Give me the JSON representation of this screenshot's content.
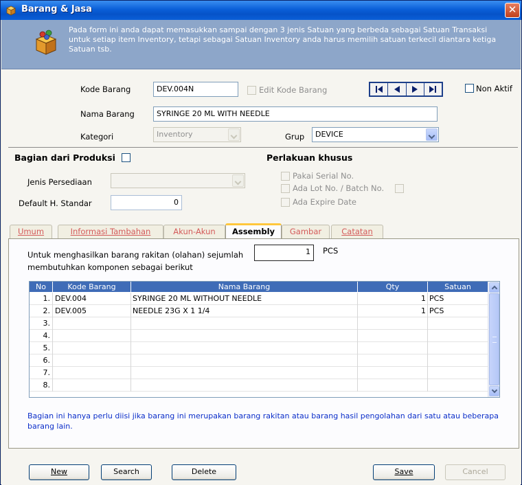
{
  "window": {
    "title": "Barang & Jasa",
    "close_glyph": "✕",
    "icon": "box-icon"
  },
  "info": {
    "text": "Pada form ini anda dapat memasukkan sampai dengan 3 jenis Satuan yang berbeda sebagai Satuan Transaksi untuk setiap item Inventory, tetapi sebagai Satuan Inventory anda harus memilih satuan terkecil diantara ketiga Satuan  tsb.",
    "icon": "package-icon"
  },
  "header": {
    "kode_label": "Kode Barang",
    "kode_value": "DEV.004N",
    "edit_kode_label": "Edit Kode Barang",
    "nama_label": "Nama Barang",
    "nama_value": "SYRINGE 20 ML WITH NEEDLE",
    "kategori_label": "Kategori",
    "kategori_value": "Inventory",
    "grup_label": "Grup",
    "grup_value": "DEVICE",
    "non_aktif_label": "Non Aktif"
  },
  "produksi": {
    "title": "Bagian dari Produksi",
    "jenis_label": "Jenis Persediaan",
    "jenis_value": "",
    "default_label": "Default H. Standar",
    "default_value": "0"
  },
  "perlakuan": {
    "title": "Perlakuan khusus",
    "serial_label": "Pakai Serial No.",
    "lot_label": "Ada Lot No. / Batch No.",
    "expire_label": "Ada Expire Date"
  },
  "tabs": [
    {
      "label": "Umum"
    },
    {
      "label": "Informasi Tambahan"
    },
    {
      "label": "Akun-Akun"
    },
    {
      "label": "Assembly"
    },
    {
      "label": "Gambar"
    },
    {
      "label": "Catatan"
    }
  ],
  "assembly": {
    "intro_line1": "Untuk menghasilkan barang rakitan (olahan) sejumlah",
    "intro_line2": "membutuhkan komponen sebagai berikut",
    "qty_value": "1",
    "unit": "PCS",
    "columns": [
      "No",
      "Kode Barang",
      "Nama Barang",
      "Qty",
      "Satuan"
    ],
    "rows": [
      {
        "no": "1.",
        "kode": "DEV.004",
        "nama": "SYRINGE 20 ML WITHOUT NEEDLE",
        "qty": "1",
        "satuan": "PCS"
      },
      {
        "no": "2.",
        "kode": "DEV.005",
        "nama": "NEEDLE 23G X 1 1/4",
        "qty": "1",
        "satuan": "PCS"
      },
      {
        "no": "3.",
        "kode": "",
        "nama": "",
        "qty": "",
        "satuan": ""
      },
      {
        "no": "4.",
        "kode": "",
        "nama": "",
        "qty": "",
        "satuan": ""
      },
      {
        "no": "5.",
        "kode": "",
        "nama": "",
        "qty": "",
        "satuan": ""
      },
      {
        "no": "6.",
        "kode": "",
        "nama": "",
        "qty": "",
        "satuan": ""
      },
      {
        "no": "7.",
        "kode": "",
        "nama": "",
        "qty": "",
        "satuan": ""
      },
      {
        "no": "8.",
        "kode": "",
        "nama": "",
        "qty": "",
        "satuan": ""
      }
    ],
    "note": "Bagian ini hanya perlu diisi jika barang ini merupakan barang rakitan atau barang hasil pengolahan dari satu atau beberapa barang lain."
  },
  "buttons": {
    "new_label": "New",
    "search_label": "Search",
    "delete_label": "Delete",
    "save_label": "Save",
    "cancel_label": "Cancel"
  },
  "colors": {
    "titlebar": "#0a5fd8",
    "info_bg": "#8da6c9",
    "grid_header": "#3f6cb7",
    "active_tab_accent": "#ffc73c",
    "tab_text": "#d45a5a",
    "note_text": "#0b2ec9"
  }
}
